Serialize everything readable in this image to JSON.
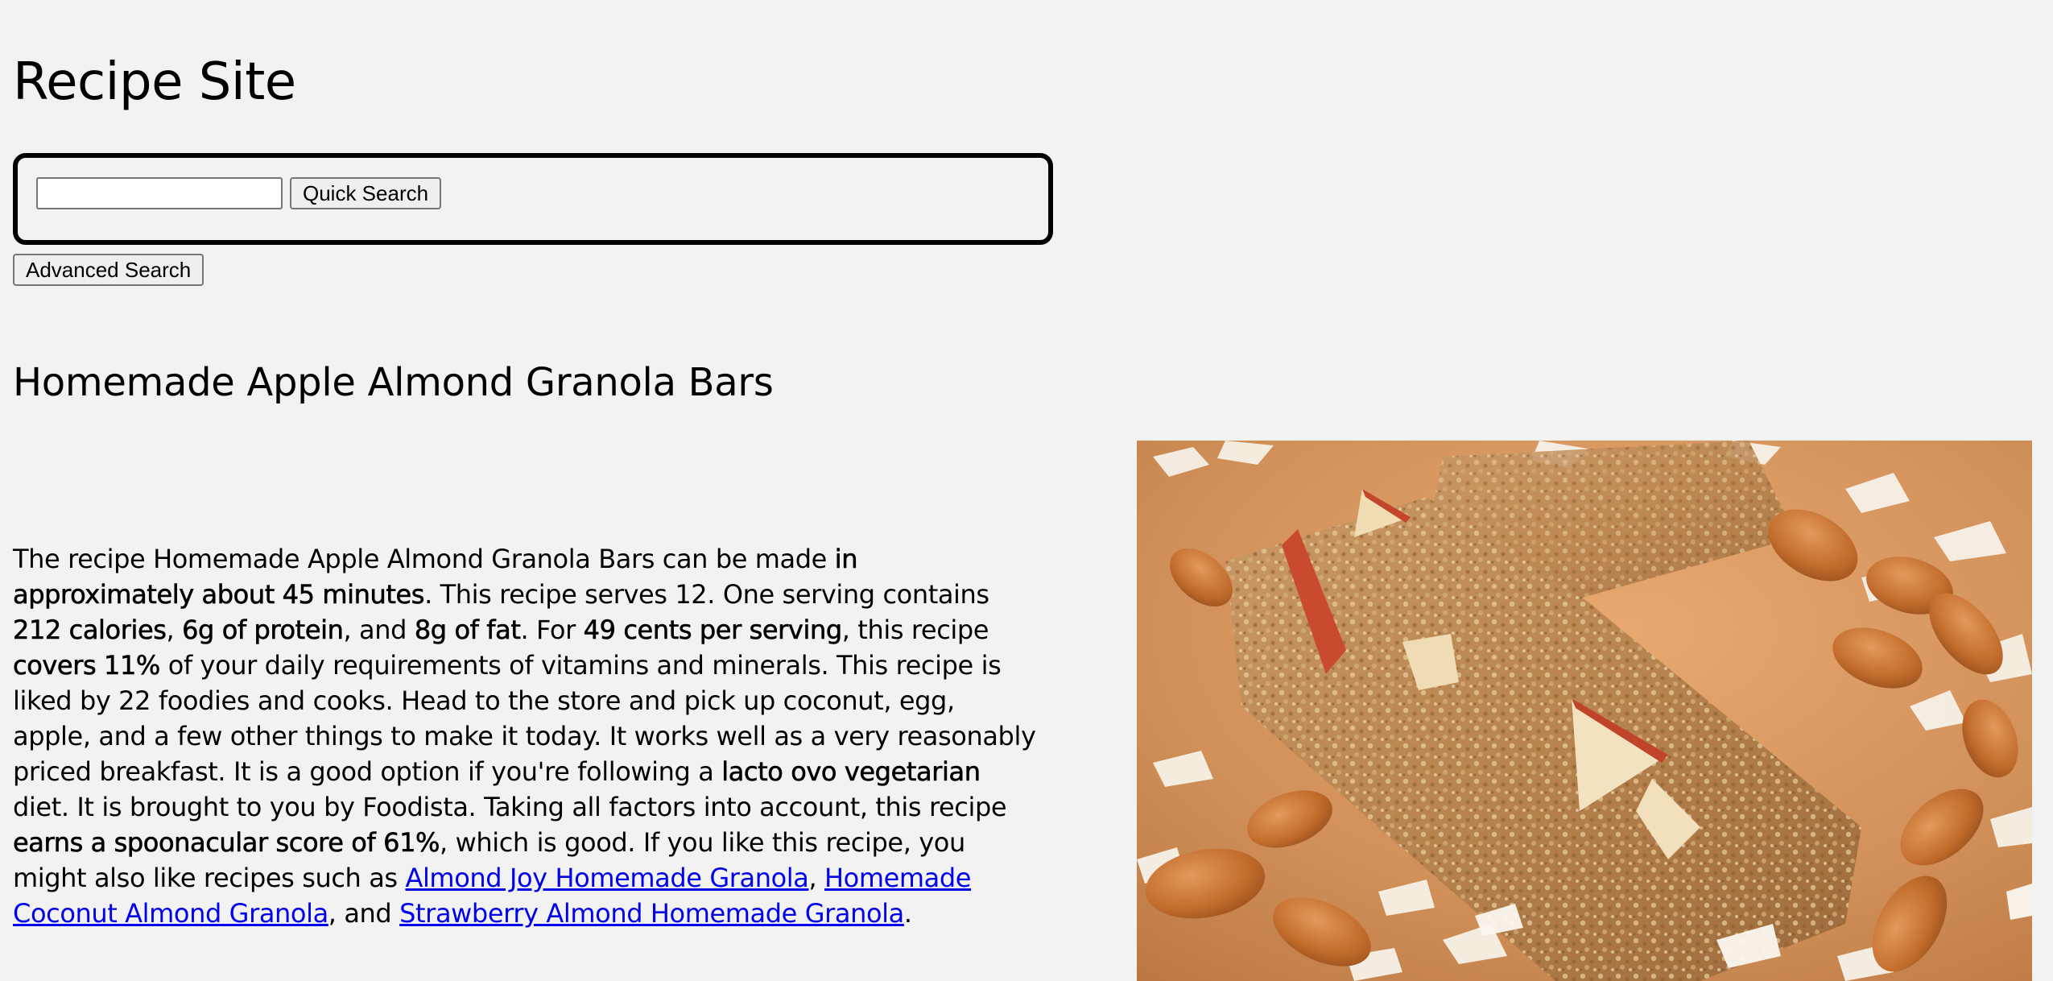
{
  "site": {
    "title": "Recipe Site"
  },
  "search": {
    "query": "",
    "placeholder": "",
    "quick_search_label": "Quick Search",
    "advanced_search_label": "Advanced Search"
  },
  "recipe": {
    "title": "Homemade Apple Almond Granola Bars",
    "summary": {
      "s01": "The recipe Homemade Apple Almond Granola Bars can be made ",
      "s02": "in approximately about 45 minutes",
      "s03": ". This recipe serves 12. One serving contains ",
      "s04": "212 calories",
      "s05": ", ",
      "s06": "6g of protein",
      "s07": ", and ",
      "s08": "8g of fat",
      "s09": ". For ",
      "s10": "49 cents per serving",
      "s11": ", this recipe ",
      "s12": "covers 11%",
      "s13": " of your daily requirements of vitamins and minerals. This recipe is liked by 22 foodies and cooks. Head to the store and pick up coconut, egg, apple, and a few other things to make it today. It works well as a very reasonably priced breakfast. It is a good option if you're following a ",
      "s14": "lacto ovo vegetarian",
      "s15": " diet. It is brought to you by Foodista. Taking all factors into account, this recipe ",
      "s16": "earns a spoonacular score of 61%",
      "s17": ", which is good. If you like this recipe, you might also like recipes such as ",
      "link1": "Almond Joy Homemade Granola",
      "s18": ", ",
      "link2": "Homemade Coconut Almond Granola",
      "s19": ", and ",
      "link3": "Strawberry Almond Homemade Granola",
      "s20": "."
    }
  },
  "colors": {
    "background": "#f2f2f2",
    "link": "#0000ee",
    "search_border": "#000000"
  },
  "icons": {
    "recipe_image": "granola-bars-photo"
  }
}
